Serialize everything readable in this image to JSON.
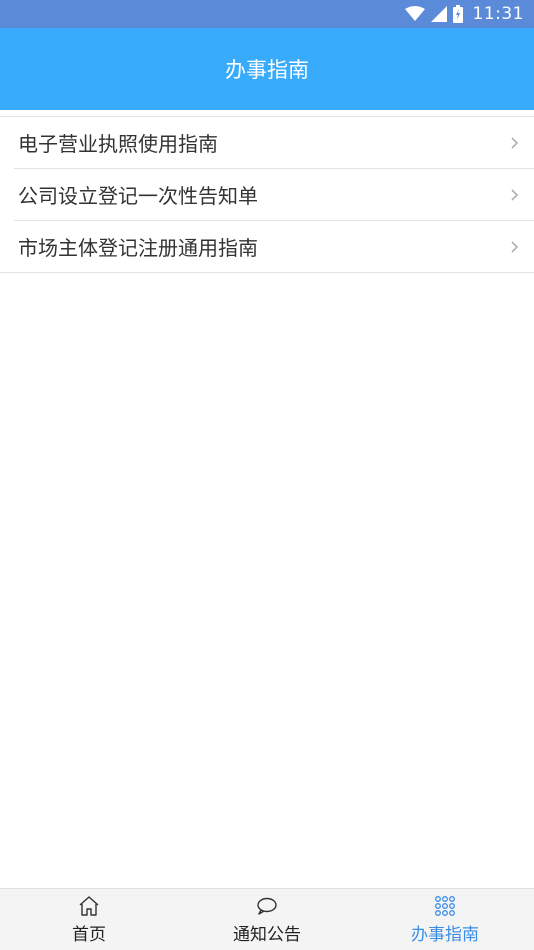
{
  "status_bar": {
    "time": "11:31",
    "icons": [
      "wifi-icon",
      "signal-icon",
      "battery-charging-icon"
    ]
  },
  "header": {
    "title": "办事指南"
  },
  "guides": [
    {
      "label": "电子营业执照使用指南",
      "icon": "chevron-right-icon"
    },
    {
      "label": "公司设立登记一次性告知单",
      "icon": "chevron-right-icon"
    },
    {
      "label": "市场主体登记注册通用指南",
      "icon": "chevron-right-icon"
    }
  ],
  "tabs": [
    {
      "label": "首页",
      "icon": "home-icon",
      "active": false
    },
    {
      "label": "通知公告",
      "icon": "chat-bubble-icon",
      "active": false
    },
    {
      "label": "办事指南",
      "icon": "grid-dots-icon",
      "active": true
    }
  ],
  "colors": {
    "status_bar": "#5b8ad9",
    "header": "#39abfd",
    "active_tab": "#3a8ee8",
    "tab_bar": "#f4f4f4",
    "divider": "#e3e3e3"
  }
}
